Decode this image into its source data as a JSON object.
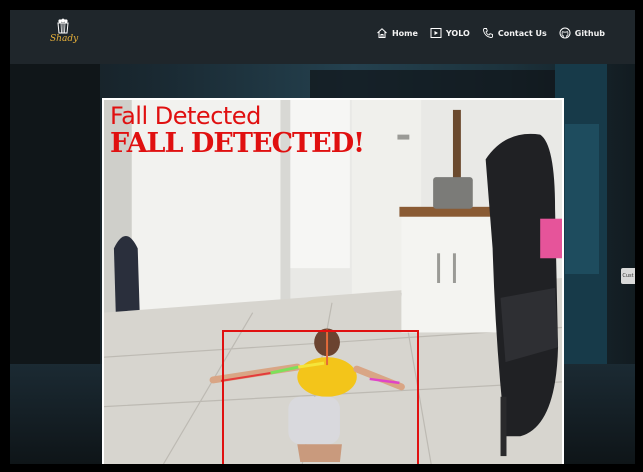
{
  "brand": {
    "name": "Shady",
    "icon": "popcorn-icon",
    "color": "#e8b13a"
  },
  "nav": {
    "items": [
      {
        "label": "Home",
        "icon": "home-icon"
      },
      {
        "label": "YOLO",
        "icon": "play-icon"
      },
      {
        "label": "Contact Us",
        "icon": "phone-icon"
      },
      {
        "label": "Github",
        "icon": "github-icon"
      }
    ]
  },
  "side_tab": {
    "label": "Cust"
  },
  "detection": {
    "label_primary": "Fall Detected",
    "label_secondary": "FALL DETECTED!",
    "box_color": "#e01010"
  }
}
